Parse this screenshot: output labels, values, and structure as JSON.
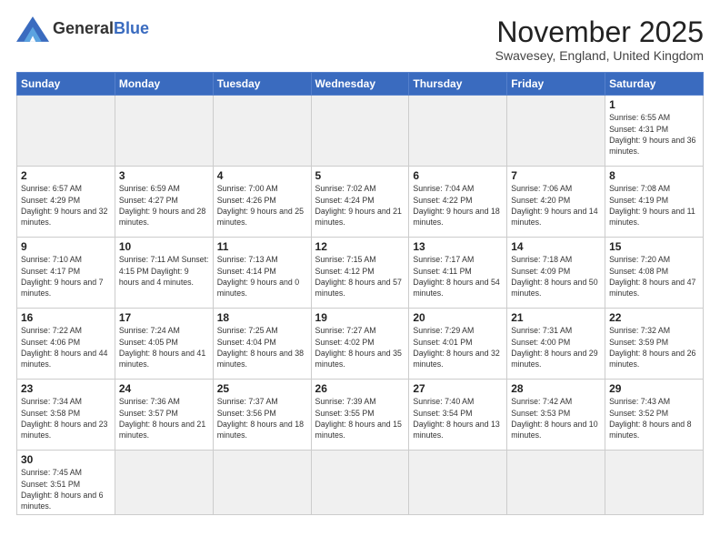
{
  "header": {
    "logo_general": "General",
    "logo_blue": "Blue",
    "month_title": "November 2025",
    "location": "Swavesey, England, United Kingdom"
  },
  "days_of_week": [
    "Sunday",
    "Monday",
    "Tuesday",
    "Wednesday",
    "Thursday",
    "Friday",
    "Saturday"
  ],
  "weeks": [
    [
      {
        "day": "",
        "empty": true
      },
      {
        "day": "",
        "empty": true
      },
      {
        "day": "",
        "empty": true
      },
      {
        "day": "",
        "empty": true
      },
      {
        "day": "",
        "empty": true
      },
      {
        "day": "",
        "empty": true
      },
      {
        "day": "1",
        "info": "Sunrise: 6:55 AM\nSunset: 4:31 PM\nDaylight: 9 hours\nand 36 minutes."
      }
    ],
    [
      {
        "day": "2",
        "info": "Sunrise: 6:57 AM\nSunset: 4:29 PM\nDaylight: 9 hours\nand 32 minutes."
      },
      {
        "day": "3",
        "info": "Sunrise: 6:59 AM\nSunset: 4:27 PM\nDaylight: 9 hours\nand 28 minutes."
      },
      {
        "day": "4",
        "info": "Sunrise: 7:00 AM\nSunset: 4:26 PM\nDaylight: 9 hours\nand 25 minutes."
      },
      {
        "day": "5",
        "info": "Sunrise: 7:02 AM\nSunset: 4:24 PM\nDaylight: 9 hours\nand 21 minutes."
      },
      {
        "day": "6",
        "info": "Sunrise: 7:04 AM\nSunset: 4:22 PM\nDaylight: 9 hours\nand 18 minutes."
      },
      {
        "day": "7",
        "info": "Sunrise: 7:06 AM\nSunset: 4:20 PM\nDaylight: 9 hours\nand 14 minutes."
      },
      {
        "day": "8",
        "info": "Sunrise: 7:08 AM\nSunset: 4:19 PM\nDaylight: 9 hours\nand 11 minutes."
      }
    ],
    [
      {
        "day": "9",
        "info": "Sunrise: 7:10 AM\nSunset: 4:17 PM\nDaylight: 9 hours\nand 7 minutes."
      },
      {
        "day": "10",
        "info": "Sunrise: 7:11 AM\nSunset: 4:15 PM\nDaylight: 9 hours\nand 4 minutes."
      },
      {
        "day": "11",
        "info": "Sunrise: 7:13 AM\nSunset: 4:14 PM\nDaylight: 9 hours\nand 0 minutes."
      },
      {
        "day": "12",
        "info": "Sunrise: 7:15 AM\nSunset: 4:12 PM\nDaylight: 8 hours\nand 57 minutes."
      },
      {
        "day": "13",
        "info": "Sunrise: 7:17 AM\nSunset: 4:11 PM\nDaylight: 8 hours\nand 54 minutes."
      },
      {
        "day": "14",
        "info": "Sunrise: 7:18 AM\nSunset: 4:09 PM\nDaylight: 8 hours\nand 50 minutes."
      },
      {
        "day": "15",
        "info": "Sunrise: 7:20 AM\nSunset: 4:08 PM\nDaylight: 8 hours\nand 47 minutes."
      }
    ],
    [
      {
        "day": "16",
        "info": "Sunrise: 7:22 AM\nSunset: 4:06 PM\nDaylight: 8 hours\nand 44 minutes."
      },
      {
        "day": "17",
        "info": "Sunrise: 7:24 AM\nSunset: 4:05 PM\nDaylight: 8 hours\nand 41 minutes."
      },
      {
        "day": "18",
        "info": "Sunrise: 7:25 AM\nSunset: 4:04 PM\nDaylight: 8 hours\nand 38 minutes."
      },
      {
        "day": "19",
        "info": "Sunrise: 7:27 AM\nSunset: 4:02 PM\nDaylight: 8 hours\nand 35 minutes."
      },
      {
        "day": "20",
        "info": "Sunrise: 7:29 AM\nSunset: 4:01 PM\nDaylight: 8 hours\nand 32 minutes."
      },
      {
        "day": "21",
        "info": "Sunrise: 7:31 AM\nSunset: 4:00 PM\nDaylight: 8 hours\nand 29 minutes."
      },
      {
        "day": "22",
        "info": "Sunrise: 7:32 AM\nSunset: 3:59 PM\nDaylight: 8 hours\nand 26 minutes."
      }
    ],
    [
      {
        "day": "23",
        "info": "Sunrise: 7:34 AM\nSunset: 3:58 PM\nDaylight: 8 hours\nand 23 minutes."
      },
      {
        "day": "24",
        "info": "Sunrise: 7:36 AM\nSunset: 3:57 PM\nDaylight: 8 hours\nand 21 minutes."
      },
      {
        "day": "25",
        "info": "Sunrise: 7:37 AM\nSunset: 3:56 PM\nDaylight: 8 hours\nand 18 minutes."
      },
      {
        "day": "26",
        "info": "Sunrise: 7:39 AM\nSunset: 3:55 PM\nDaylight: 8 hours\nand 15 minutes."
      },
      {
        "day": "27",
        "info": "Sunrise: 7:40 AM\nSunset: 3:54 PM\nDaylight: 8 hours\nand 13 minutes."
      },
      {
        "day": "28",
        "info": "Sunrise: 7:42 AM\nSunset: 3:53 PM\nDaylight: 8 hours\nand 10 minutes."
      },
      {
        "day": "29",
        "info": "Sunrise: 7:43 AM\nSunset: 3:52 PM\nDaylight: 8 hours\nand 8 minutes."
      }
    ],
    [
      {
        "day": "30",
        "info": "Sunrise: 7:45 AM\nSunset: 3:51 PM\nDaylight: 8 hours\nand 6 minutes.",
        "last": true
      },
      {
        "day": "",
        "empty": true,
        "last": true
      },
      {
        "day": "",
        "empty": true,
        "last": true
      },
      {
        "day": "",
        "empty": true,
        "last": true
      },
      {
        "day": "",
        "empty": true,
        "last": true
      },
      {
        "day": "",
        "empty": true,
        "last": true
      },
      {
        "day": "",
        "empty": true,
        "last": true
      }
    ]
  ]
}
